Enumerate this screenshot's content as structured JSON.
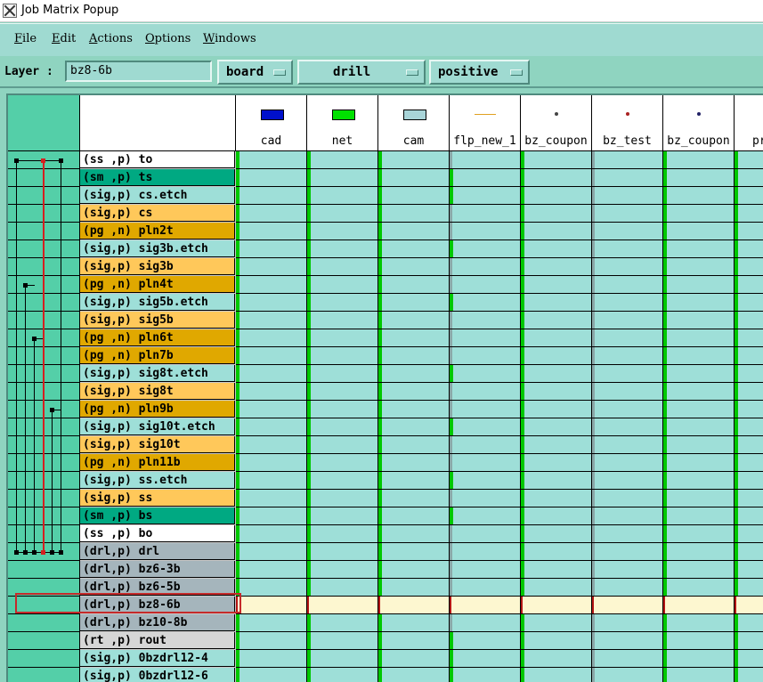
{
  "window": {
    "title": "Job Matrix Popup"
  },
  "menu": {
    "items": [
      {
        "label": "File",
        "key": "F"
      },
      {
        "label": "Edit",
        "key": "E"
      },
      {
        "label": "Actions",
        "key": "A"
      },
      {
        "label": "Options",
        "key": "O"
      },
      {
        "label": "Windows",
        "key": "W"
      }
    ]
  },
  "layerbar": {
    "label": "Layer :",
    "value": "bz8-6b",
    "context_dropdown": "board",
    "type_dropdown": "drill",
    "polarity_dropdown": "positive"
  },
  "colors": {
    "signal_pos": "#ffc85a",
    "plane_neg": "#e0a800",
    "mask": "#00a982",
    "silk": "#ffffff",
    "drill": "#a5b5bc",
    "rout": "#d6d6d6",
    "etch": "#9edfd8",
    "selected": "#fdf7d0",
    "drill_span_line": "#d42020"
  },
  "columns": [
    {
      "name": "cad",
      "swatch": "#0010cc",
      "icon": "filled-rect-icon"
    },
    {
      "name": "net",
      "swatch": "#00e000",
      "icon": "filled-rect-icon"
    },
    {
      "name": "cam",
      "swatch": "#a8d4d8",
      "icon": "filled-rect-icon"
    },
    {
      "name": "flp_new_1",
      "swatch": "#e0a020",
      "icon": "line-icon"
    },
    {
      "name": "bz_coupon",
      "swatch": "#444444",
      "icon": "dot-icon"
    },
    {
      "name": "bz_test",
      "swatch": "#aa2222",
      "icon": "dot-icon"
    },
    {
      "name": "bz_coupon",
      "swatch": "#222266",
      "icon": "dot-icon"
    },
    {
      "name": "pr",
      "swatch": "#3366aa",
      "icon": "board-icon"
    }
  ],
  "rows": [
    {
      "label": "(ss ,p) to",
      "kind": "silk"
    },
    {
      "label": "(sm ,p) ts",
      "kind": "mask"
    },
    {
      "label": "(sig,p) cs.etch",
      "kind": "etch"
    },
    {
      "label": "(sig,p) cs",
      "kind": "signal_pos"
    },
    {
      "label": "(pg ,n) pln2t",
      "kind": "plane_neg"
    },
    {
      "label": "(sig,p) sig3b.etch",
      "kind": "etch"
    },
    {
      "label": "(sig,p) sig3b",
      "kind": "signal_pos"
    },
    {
      "label": "(pg ,n) pln4t",
      "kind": "plane_neg"
    },
    {
      "label": "(sig,p) sig5b.etch",
      "kind": "etch"
    },
    {
      "label": "(sig,p) sig5b",
      "kind": "signal_pos"
    },
    {
      "label": "(pg ,n) pln6t",
      "kind": "plane_neg"
    },
    {
      "label": "(pg ,n) pln7b",
      "kind": "plane_neg"
    },
    {
      "label": "(sig,p) sig8t.etch",
      "kind": "etch"
    },
    {
      "label": "(sig,p) sig8t",
      "kind": "signal_pos"
    },
    {
      "label": "(pg ,n) pln9b",
      "kind": "plane_neg"
    },
    {
      "label": "(sig,p) sig10t.etch",
      "kind": "etch"
    },
    {
      "label": "(sig,p) sig10t",
      "kind": "signal_pos"
    },
    {
      "label": "(pg ,n) pln11b",
      "kind": "plane_neg"
    },
    {
      "label": "(sig,p) ss.etch",
      "kind": "etch"
    },
    {
      "label": "(sig,p) ss",
      "kind": "signal_pos"
    },
    {
      "label": "(sm ,p) bs",
      "kind": "mask"
    },
    {
      "label": "(ss ,p) bo",
      "kind": "silk"
    },
    {
      "label": "(drl,p) drl",
      "kind": "drill"
    },
    {
      "label": "(drl,p) bz6-3b",
      "kind": "drill"
    },
    {
      "label": "(drl,p) bz6-5b",
      "kind": "drill"
    },
    {
      "label": "(drl,p) bz8-6b",
      "kind": "drill",
      "selected": true
    },
    {
      "label": "(drl,p) bz10-8b",
      "kind": "drill"
    },
    {
      "label": "(rt ,p) rout",
      "kind": "rout"
    },
    {
      "label": "(sig,p) 0bzdrl12-4",
      "kind": "etch"
    },
    {
      "label": "(sig,p) 0bzdrl12-6",
      "kind": "etch"
    }
  ]
}
